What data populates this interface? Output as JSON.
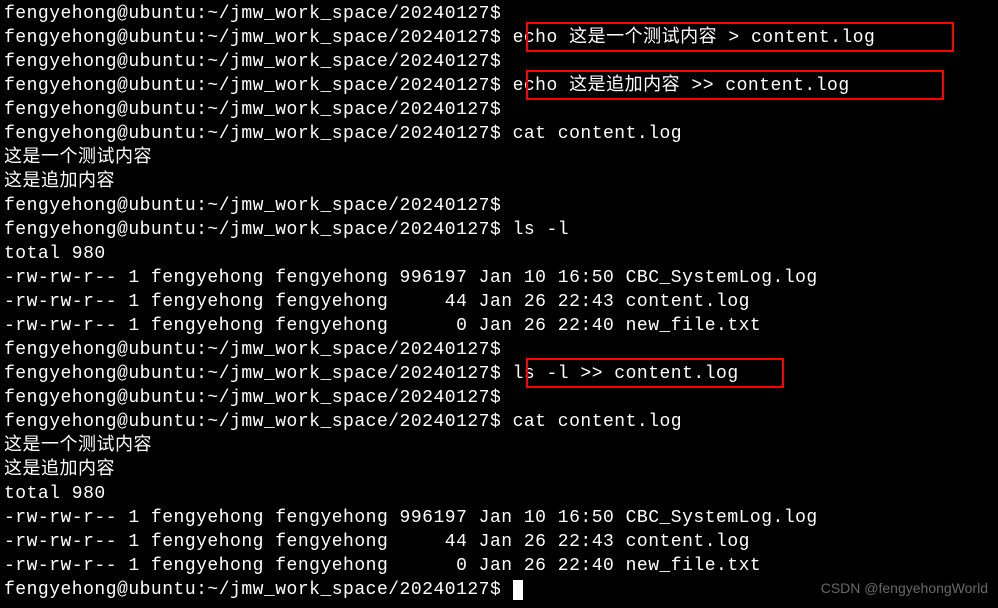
{
  "prompt": "fengyehong@ubuntu:~/jmw_work_space/20240127$",
  "lines": [
    {
      "type": "prompt",
      "cmd": ""
    },
    {
      "type": "prompt",
      "cmd": " echo 这是一个测试内容 > content.log"
    },
    {
      "type": "prompt",
      "cmd": ""
    },
    {
      "type": "prompt",
      "cmd": " echo 这是追加内容 >> content.log"
    },
    {
      "type": "prompt",
      "cmd": ""
    },
    {
      "type": "prompt",
      "cmd": " cat content.log"
    },
    {
      "type": "output",
      "text": "这是一个测试内容"
    },
    {
      "type": "output",
      "text": "这是追加内容"
    },
    {
      "type": "prompt",
      "cmd": ""
    },
    {
      "type": "prompt",
      "cmd": " ls -l"
    },
    {
      "type": "output",
      "text": "total 980"
    },
    {
      "type": "output",
      "text": "-rw-rw-r-- 1 fengyehong fengyehong 996197 Jan 10 16:50 CBC_SystemLog.log"
    },
    {
      "type": "output",
      "text": "-rw-rw-r-- 1 fengyehong fengyehong     44 Jan 26 22:43 content.log"
    },
    {
      "type": "output",
      "text": "-rw-rw-r-- 1 fengyehong fengyehong      0 Jan 26 22:40 new_file.txt"
    },
    {
      "type": "prompt",
      "cmd": ""
    },
    {
      "type": "prompt",
      "cmd": " ls -l >> content.log"
    },
    {
      "type": "prompt",
      "cmd": ""
    },
    {
      "type": "prompt",
      "cmd": " cat content.log"
    },
    {
      "type": "output",
      "text": "这是一个测试内容"
    },
    {
      "type": "output",
      "text": "这是追加内容"
    },
    {
      "type": "output",
      "text": "total 980"
    },
    {
      "type": "output",
      "text": "-rw-rw-r-- 1 fengyehong fengyehong 996197 Jan 10 16:50 CBC_SystemLog.log"
    },
    {
      "type": "output",
      "text": "-rw-rw-r-- 1 fengyehong fengyehong     44 Jan 26 22:43 content.log"
    },
    {
      "type": "output",
      "text": "-rw-rw-r-- 1 fengyehong fengyehong      0 Jan 26 22:40 new_file.txt"
    },
    {
      "type": "prompt_cursor",
      "cmd": " "
    }
  ],
  "watermark": "CSDN @fengyehongWorld"
}
